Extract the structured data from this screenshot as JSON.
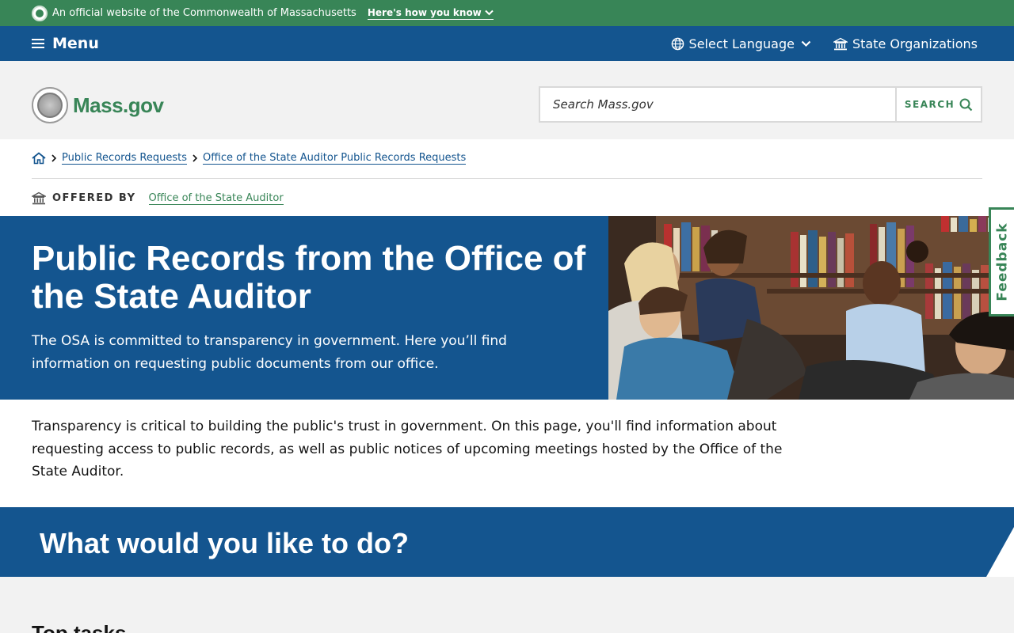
{
  "official_banner": {
    "text": "An official website of the Commonwealth of Massachusetts",
    "link": "Here's how you know"
  },
  "utility_nav": {
    "menu_label": "Menu",
    "language_label": "Select Language",
    "orgs_label": "State Organizations"
  },
  "header": {
    "logo_text": "Mass.gov",
    "search_placeholder": "Search Mass.gov",
    "search_button": "SEARCH"
  },
  "breadcrumb": [
    "Public Records Requests",
    "Office of the State Auditor Public Records Requests"
  ],
  "offered_by": {
    "label": "OFFERED BY",
    "org": "Office of the State Auditor"
  },
  "hero": {
    "title": "Public Records from the Office of the State Auditor",
    "subtitle": "The OSA is committed to transparency in government. Here you’ll find information on requesting public documents from our office."
  },
  "feedback_label": "Feedback",
  "intro_text": "Transparency is critical to building the public's trust in government. On this page, you'll find information about requesting access to public records, as well as public notices of upcoming meetings hosted by the Office of the State Auditor.",
  "section_title": "What would you like to do?",
  "subsection_title": "Top tasks",
  "colors": {
    "green": "#388557",
    "blue": "#14558f",
    "gray_bg": "#f2f2f2"
  }
}
